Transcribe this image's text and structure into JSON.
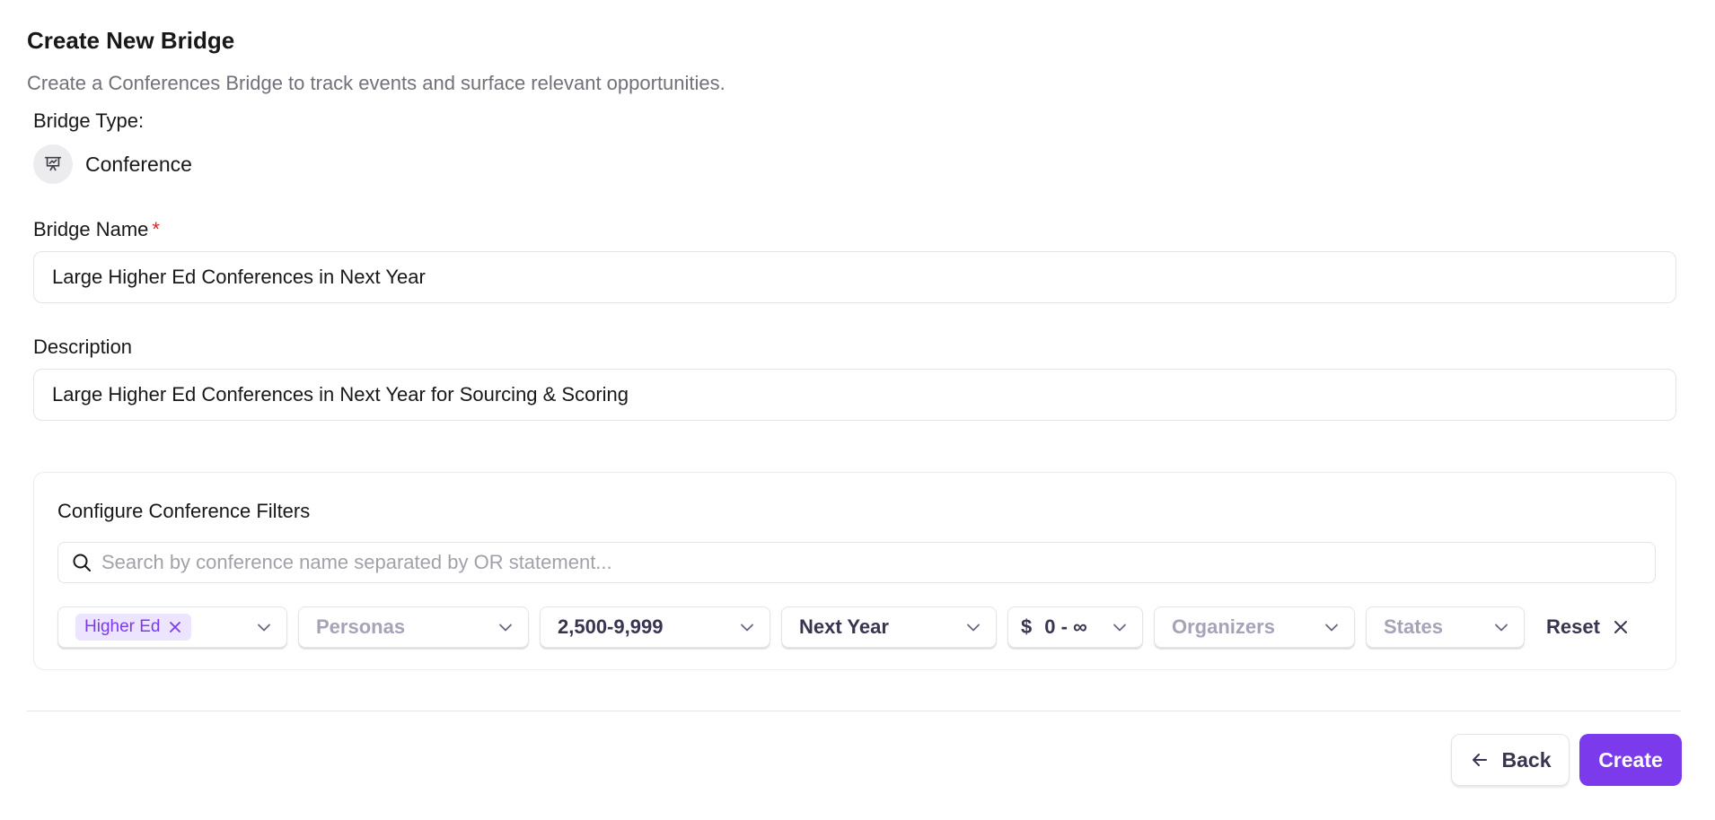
{
  "header": {
    "title": "Create New Bridge",
    "subtitle": "Create a Conferences Bridge to track events and surface relevant opportunities."
  },
  "bridge_type": {
    "label": "Bridge Type:",
    "value": "Conference",
    "icon": "presentation-chart-icon"
  },
  "bridge_name": {
    "label": "Bridge Name",
    "required_marker": "*",
    "value": "Large Higher Ed Conferences in Next Year"
  },
  "description": {
    "label": "Description",
    "value": "Large Higher Ed Conferences in Next Year for Sourcing & Scoring"
  },
  "filters": {
    "title": "Configure Conference Filters",
    "search_placeholder": "Search by conference name separated by OR statement...",
    "industry_chip": "Higher Ed",
    "personas": "Personas",
    "attendance": "2,500-9,999",
    "timeframe": "Next Year",
    "budget_symbol": "$",
    "budget_range": "0 - ∞",
    "organizers": "Organizers",
    "states": "States",
    "reset_label": "Reset"
  },
  "footer": {
    "back_label": "Back",
    "create_label": "Create"
  },
  "colors": {
    "accent": "#7c3aed",
    "chip_bg": "#ede4ff",
    "required": "#dc2626"
  }
}
